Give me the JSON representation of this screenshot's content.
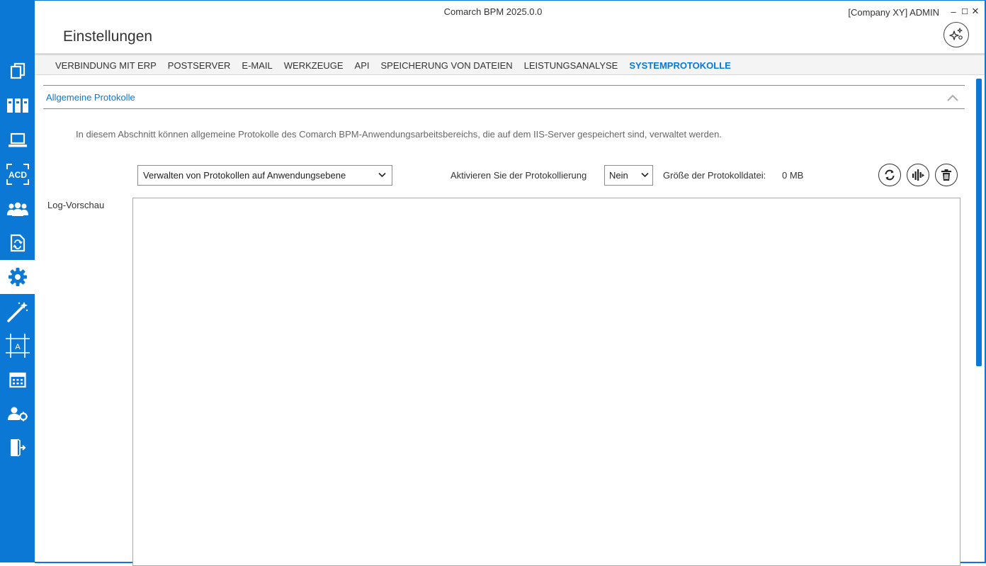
{
  "window": {
    "app_title": "Comarch BPM 2025.0.0",
    "user_info": "[Company XY]  ADMIN",
    "minimize_glyph": "–",
    "maximize_glyph": "☐",
    "close_glyph": "✕"
  },
  "page": {
    "title": "Einstellungen"
  },
  "sidebar": {
    "background_color": "#0a78d4",
    "items": [
      {
        "icon": "documents-icon"
      },
      {
        "icon": "folders-icon"
      },
      {
        "icon": "laptop-icon"
      },
      {
        "icon": "acd-icon",
        "text": "ACD"
      },
      {
        "icon": "users-group-icon"
      },
      {
        "icon": "document-sync-icon"
      },
      {
        "icon": "gear-icon",
        "active": true
      },
      {
        "icon": "magic-wand-icon"
      },
      {
        "icon": "designer-frame-icon",
        "text": "A"
      },
      {
        "icon": "calendar-icon"
      },
      {
        "icon": "user-settings-icon"
      },
      {
        "icon": "logout-door-icon"
      }
    ]
  },
  "tabs": [
    {
      "label": "VERBINDUNG MIT ERP"
    },
    {
      "label": "POSTSERVER"
    },
    {
      "label": "E-MAIL"
    },
    {
      "label": "WERKZEUGE"
    },
    {
      "label": "API"
    },
    {
      "label": "SPEICHERUNG VON DATEIEN"
    },
    {
      "label": "LEISTUNGSANALYSE"
    },
    {
      "label": "SYSTEMPROTOKOLLE",
      "active": true
    }
  ],
  "section": {
    "title": "Allgemeine Protokolle",
    "description": "In diesem Abschnitt können allgemeine Protokolle des Comarch BPM-Anwendungsarbeitsbereichs, die auf dem IIS-Server gespeichert sind, verwaltet werden.",
    "log_scope_select": {
      "value": "Verwalten von Protokollen auf Anwendungsebene"
    },
    "logging_label": "Aktivieren Sie der Protokollierung",
    "logging_select": {
      "value": "Nein"
    },
    "file_size_label": "Größe der Protokolldatei:",
    "file_size_value": "0 MB",
    "actions": [
      {
        "icon": "refresh-icon"
      },
      {
        "icon": "download-log-icon"
      },
      {
        "icon": "trash-icon"
      }
    ],
    "preview_label": "Log-Vorschau",
    "preview_content": ""
  },
  "colors": {
    "accent": "#0a78d4",
    "text": "#333333",
    "muted_text": "#666666"
  }
}
